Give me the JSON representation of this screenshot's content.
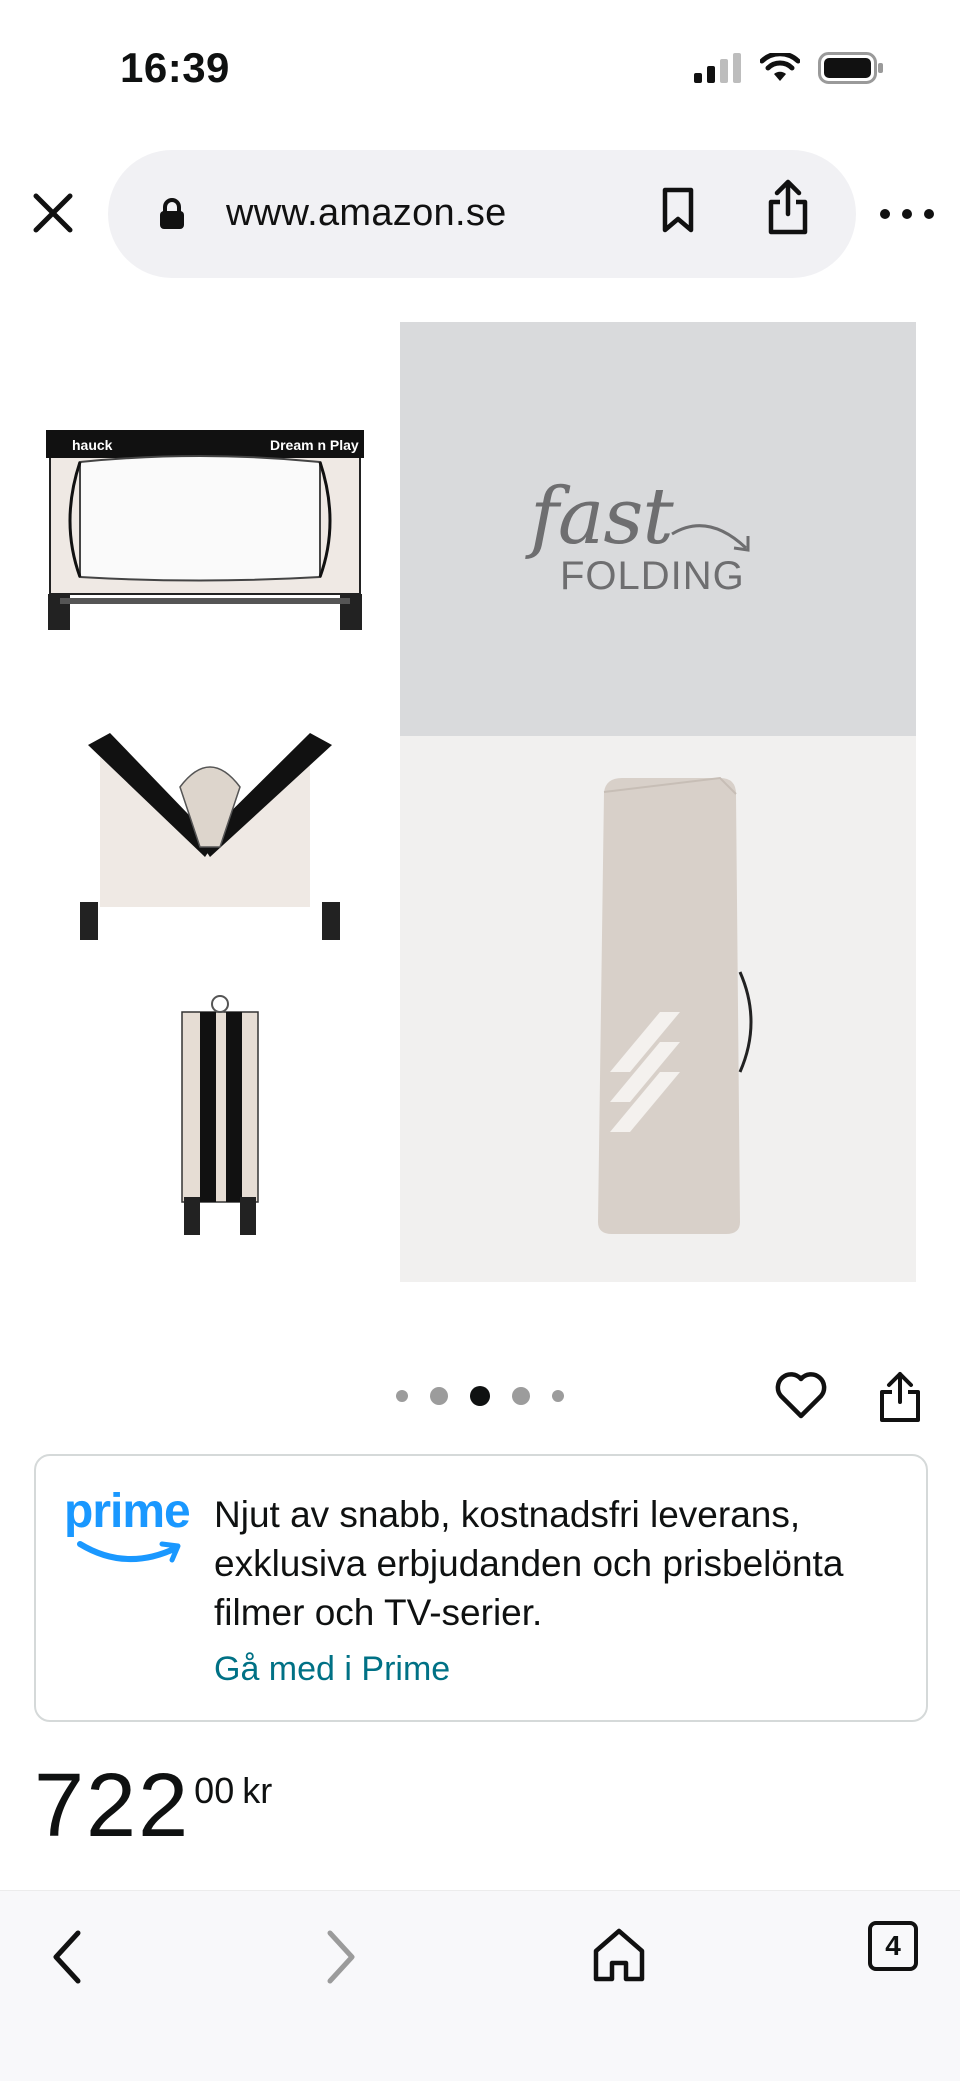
{
  "status_bar": {
    "time": "16:39",
    "icons": [
      "cellular-signal-icon",
      "wifi-icon",
      "battery-icon"
    ]
  },
  "browser": {
    "url": "www.amazon.se",
    "icons": [
      "close-icon",
      "lock-icon",
      "bookmark-icon",
      "share-icon",
      "more-icon"
    ]
  },
  "product_image": {
    "fast_text": "fast",
    "folding_text": "FOLDING",
    "brand_mark": "hauck",
    "product_label": "Dream n Play"
  },
  "carousel": {
    "total_dots": 5,
    "active_index": 2
  },
  "actions": {
    "icons": [
      "heart-icon",
      "share-icon"
    ]
  },
  "prime": {
    "logo": "prime",
    "text": "Njut av snabb, kostnadsfri leverans, exklusiva erbjudanden och prisbelönta filmer och TV-serier.",
    "link": "Gå med i Prime"
  },
  "price": {
    "whole": "722",
    "fraction": "00",
    "currency": "kr"
  },
  "toolbar": {
    "tab_count": "4",
    "icons": [
      "back-icon",
      "forward-icon",
      "home-icon",
      "tabs-icon"
    ]
  },
  "colors": {
    "prime_blue": "#1a98ff",
    "link_teal": "#007185",
    "border": "#d5d9d9"
  }
}
